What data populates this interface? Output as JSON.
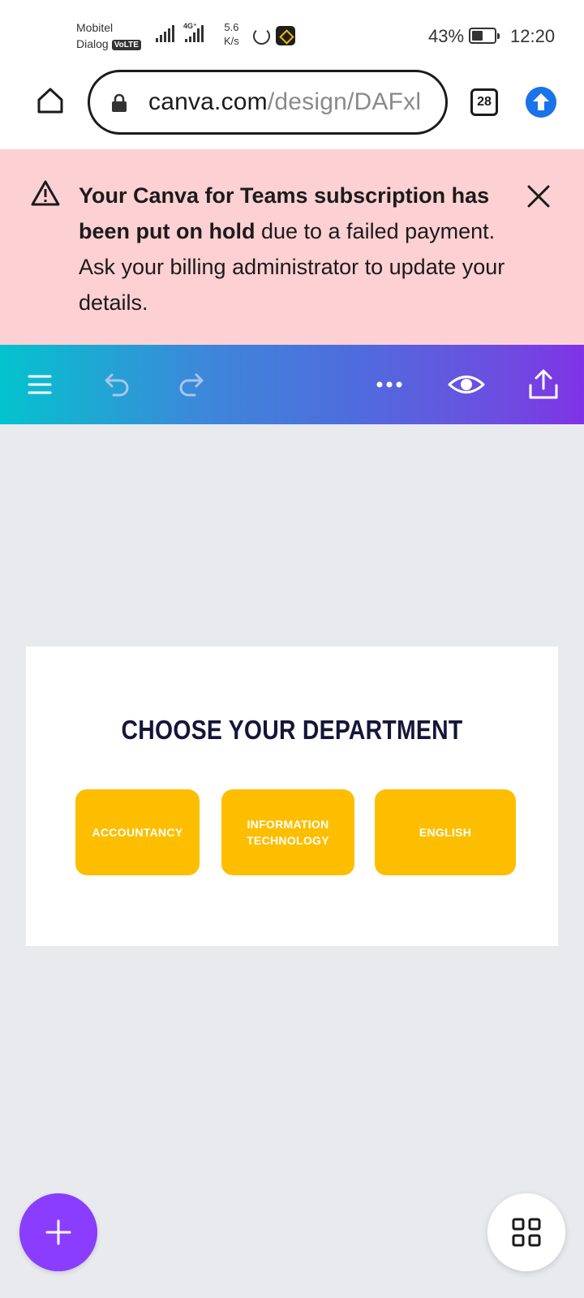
{
  "status_bar": {
    "carrier_1": "Mobitel",
    "carrier_2": "Dialog",
    "volte": "VoLTE",
    "network": "4G⁺",
    "speed_value": "5.6",
    "speed_unit": "K/s",
    "battery": "43%",
    "time": "12:20"
  },
  "browser": {
    "url_domain": "canva.com",
    "url_path": "/design/DAFxl",
    "tab_count": "28"
  },
  "banner": {
    "bold_text": "Your Canva for Teams subscription has been put on hold",
    "rest_text": " due to a failed payment. Ask your billing administrator to update your details."
  },
  "toolbar": {
    "icons": [
      "menu-icon",
      "undo-icon",
      "redo-icon",
      "more-icon",
      "preview-icon",
      "share-icon"
    ]
  },
  "design": {
    "title": "CHOOSE YOUR DEPARTMENT",
    "departments": [
      {
        "line1": "ACCOUNTANCY",
        "line2": ""
      },
      {
        "line1": "INFORMATION",
        "line2": "TECHNOLOGY"
      },
      {
        "line1": "ENGLISH",
        "line2": ""
      }
    ],
    "button_color": "#fdbe00"
  },
  "colors": {
    "banner_bg": "#fdd0d3",
    "accent_purple": "#8b3dff",
    "canvas_bg": "#e9eaee"
  }
}
